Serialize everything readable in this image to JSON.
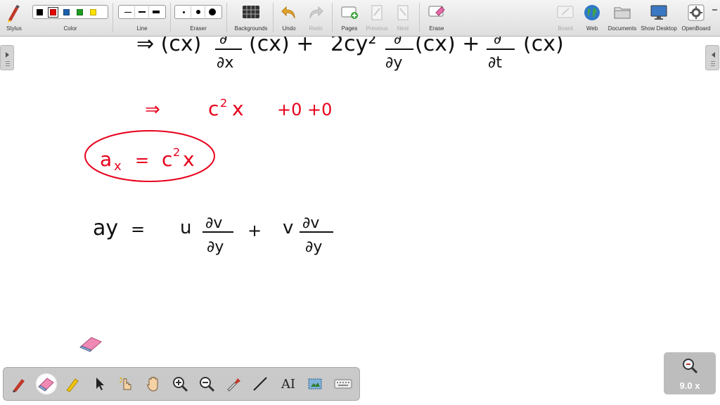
{
  "toolbar": {
    "stylus": "Stylus",
    "color": "Color",
    "line": "Line",
    "eraser": "Eraser",
    "backgrounds": "Backgrounds",
    "undo": "Undo",
    "redo": "Redo",
    "pages": "Pages",
    "previous": "Previous",
    "next": "Next",
    "erase": "Erase",
    "board": "Board",
    "web": "Web",
    "documents": "Documents",
    "show_desktop": "Show Desktop",
    "openboard": "OpenBoard",
    "colors": [
      "#000000",
      "#e00000",
      "#1c5fa8",
      "#1e9a1e",
      "#ffe000"
    ],
    "selected_color": "#e00000"
  },
  "board": {
    "line1": {
      "prefix": "⇒ (cx)",
      "frac1_num": "∂",
      "frac1_den": "∂x",
      "after_frac1": "(cx) +",
      "term2": "2cy²",
      "frac2_num": "∂",
      "frac2_den": "∂y",
      "after_frac2": "(cx) +",
      "frac3_num": "∂",
      "frac3_den": "∂t",
      "after_frac3": "(cx)"
    },
    "line2": {
      "arrow": "⇒",
      "c": "c",
      "sup": "2",
      "x": "x",
      "rest": "+0 +0"
    },
    "boxed": {
      "a": "a",
      "sub": "x",
      "eq": "=",
      "c": "c",
      "sup": "2",
      "x": "x"
    },
    "line3": {
      "lhs": "ay",
      "eq": "=",
      "u": "u",
      "frac1_num": "∂v",
      "frac1_den": "∂y",
      "plus": "+",
      "v": "v",
      "frac2_num": "∂v",
      "frac2_den": "∂y"
    },
    "ink_color": "#e8001c"
  },
  "zoom": {
    "label": "9.0 x"
  },
  "bottom_tools": [
    "pen-icon",
    "eraser-icon",
    "highlighter-icon",
    "pointer-icon",
    "laser-pointer-icon",
    "hand-icon",
    "zoom-in-icon",
    "zoom-out-icon",
    "pipette-icon",
    "line-icon",
    "text-icon",
    "capture-icon",
    "keyboard-icon"
  ]
}
